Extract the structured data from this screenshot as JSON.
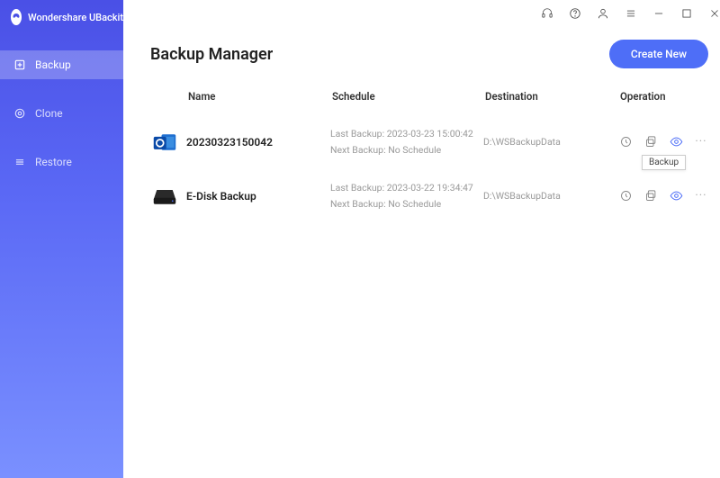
{
  "app": {
    "name": "Wondershare UBackit"
  },
  "sidebar": {
    "items": [
      {
        "label": "Backup",
        "active": true
      },
      {
        "label": "Clone",
        "active": false
      },
      {
        "label": "Restore",
        "active": false
      }
    ]
  },
  "header": {
    "title": "Backup Manager",
    "create_label": "Create New"
  },
  "columns": {
    "name": "Name",
    "schedule": "Schedule",
    "destination": "Destination",
    "operation": "Operation"
  },
  "rows": [
    {
      "icon": "outlook",
      "name": "20230323150042",
      "last": "Last Backup: 2023-03-23 15:00:42",
      "next": "Next Backup: No Schedule",
      "destination": "D:\\WSBackupData",
      "tooltip": "Backup"
    },
    {
      "icon": "disk",
      "name": "E-Disk Backup",
      "last": "Last Backup: 2023-03-22 19:34:47",
      "next": "Next Backup: No Schedule",
      "destination": "D:\\WSBackupData"
    }
  ]
}
